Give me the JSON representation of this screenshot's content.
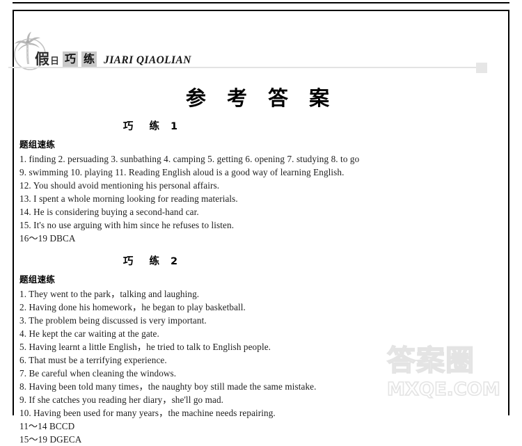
{
  "masthead": {
    "logo_cn_main": "假",
    "logo_cn_sub": "日",
    "logo_box_1": "巧",
    "logo_box_2": "练",
    "logo_pinyin": "JIARI QIAOLIAN",
    "palm_icon": "palm-tree-icon"
  },
  "document": {
    "title": "参 考 答 案"
  },
  "sections": [
    {
      "heading_cn": "巧 练",
      "heading_num": "1",
      "group_label": "题组速练",
      "lines": [
        "1. finding   2. persuading   3. sunbathing   4. camping   5. getting   6. opening   7. studying   8. to go",
        "9. swimming    10. playing    11. Reading English aloud is a good way of learning English.",
        "12. You should avoid mentioning his personal affairs.",
        "13. I spent a whole morning looking for reading materials.",
        "14. He is considering buying a second-hand car.",
        "15. It's no use arguing with him since he refuses to listen.",
        "16～19   DBCA"
      ]
    },
    {
      "heading_cn": "巧 练",
      "heading_num": "2",
      "group_label": "题组速练",
      "lines": [
        "1. They went to the park，talking and laughing.",
        "2. Having done his homework，he began to play basketball.",
        "3. The problem being discussed is very important.",
        "4. He kept the car waiting at the gate.",
        "5. Having learnt a little English，he tried to talk to English people.",
        "6. That must be a terrifying experience.",
        "7. Be careful when cleaning the windows.",
        "8. Having been told many times，the naughty boy still made the same mistake.",
        "9. If she catches you reading her diary，she'll go mad.",
        "10. Having been used for many years，the machine needs repairing.",
        "11～14   BCCD",
        "15～19   DGECA"
      ]
    }
  ],
  "watermark": {
    "cn": "答案圈",
    "en": "MXQE.COM"
  },
  "colors": {
    "frame": "#000000",
    "rule": "#e3e3e3",
    "logo_box_bg": "#c9c9c9",
    "watermark_stroke": "#e4e4e4",
    "text": "#1c1c1c"
  }
}
